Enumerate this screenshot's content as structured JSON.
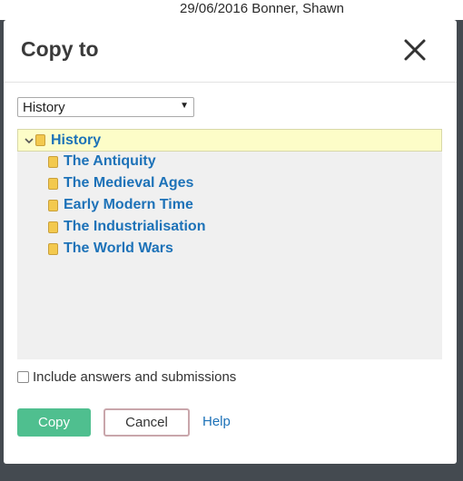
{
  "background": {
    "row_text": "29/06/2016 Bonner, Shawn"
  },
  "dialog": {
    "title": "Copy to",
    "close_icon": "close-icon"
  },
  "folder_select": {
    "value": "History"
  },
  "tree": {
    "root": {
      "label": "History",
      "expanded": true,
      "selected": true
    },
    "children": [
      {
        "label": "The Antiquity"
      },
      {
        "label": "The Medieval Ages"
      },
      {
        "label": "Early Modern Time"
      },
      {
        "label": "The Industrialisation"
      },
      {
        "label": "The World Wars"
      }
    ]
  },
  "options": {
    "include_label": "Include answers and submissions",
    "include_checked": false
  },
  "actions": {
    "copy_label": "Copy",
    "cancel_label": "Cancel",
    "help_label": "Help"
  },
  "colors": {
    "primary_button": "#4fbf8f",
    "link": "#1d72b8",
    "selected_row": "#fdfdc8",
    "folder": "#f3c94e"
  }
}
